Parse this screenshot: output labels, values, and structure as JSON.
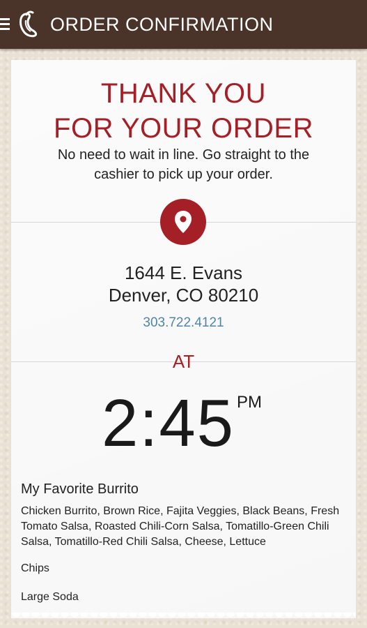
{
  "header": {
    "title": "ORDER CONFIRMATION",
    "menu_icon": "menu-icon",
    "logo_icon": "chili-pepper-logo-icon"
  },
  "confirmation": {
    "heading_line1": "THANK YOU",
    "heading_line2": "FOR YOUR ORDER",
    "message_line1": "No need to wait in line. Go straight to the",
    "message_line2": "cashier to pick up your order.",
    "location_icon": "map-pin-icon"
  },
  "location": {
    "address_line1": "1644 E. Evans",
    "address_line2": "Denver, CO 80210",
    "phone": "303.722.4121"
  },
  "pickup": {
    "at_label": "AT",
    "time": "2:45",
    "period": "PM"
  },
  "order": {
    "name": "My Favorite Burrito",
    "items": [
      "Chicken Burrito, Brown Rice, Fajita Veggies, Black Beans, Fresh Tomato Salsa, Roasted Chili-Corn Salsa, Tomatillo-Green Chili Salsa, Tomatillo-Red Chili Salsa, Cheese, Lettuce",
      "Chips",
      "Large Soda"
    ]
  },
  "colors": {
    "header_bg": "#4a3328",
    "accent_red": "#a51f27",
    "link_blue": "#4f86a8",
    "background": "#e9e1d3"
  }
}
